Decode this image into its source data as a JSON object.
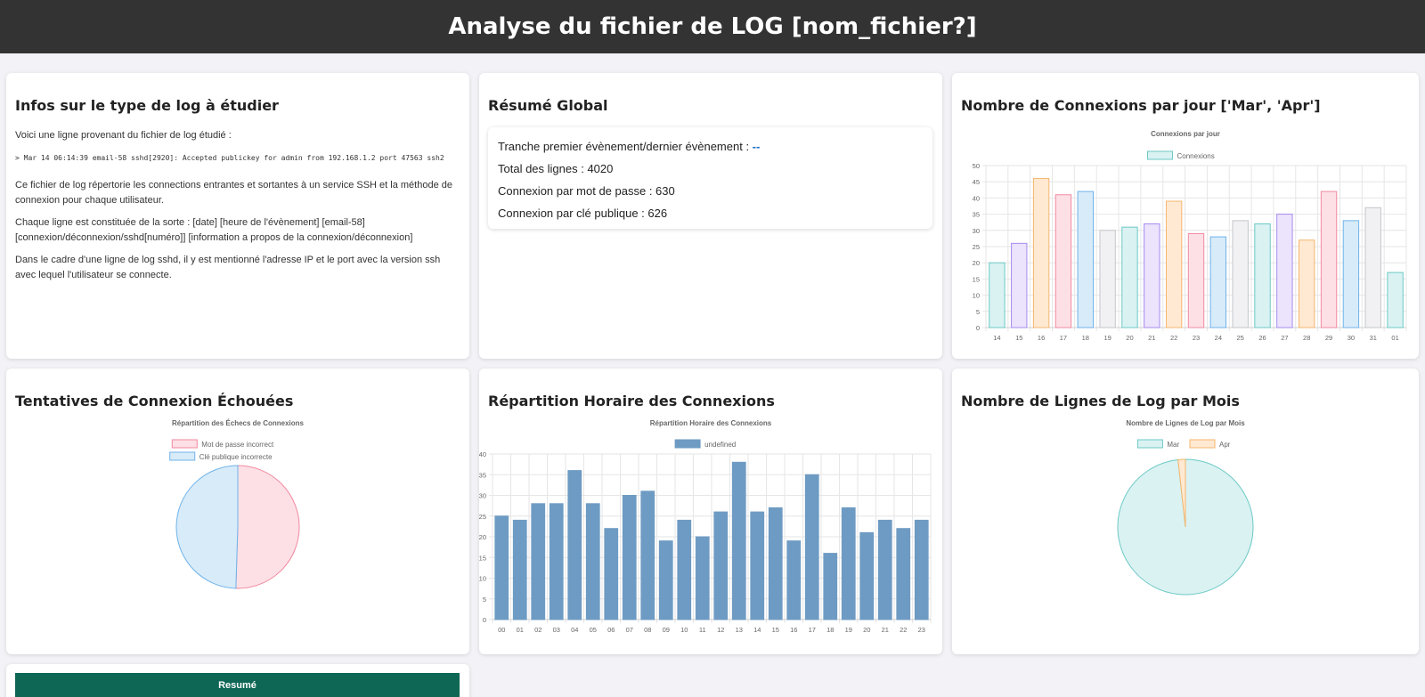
{
  "header": {
    "title": "Analyse du fichier de LOG [nom_fichier?]"
  },
  "infos": {
    "title": "Infos sur le type de log à étudier",
    "intro": "Voici une ligne provenant du fichier de log étudié :",
    "sample_line": "> Mar 14 06:14:39 email-58 sshd[2920]: Accepted publickey for admin from 192.168.1.2 port 47563 ssh2",
    "paragraph1": "Ce fichier de log répertorie les connections entrantes et sortantes à un service SSH et la méthode de connexion pour chaque utilisateur.",
    "paragraph2": "Chaque ligne est constituée de la sorte : [date] [heure de l'évènement] [email-58] [connexion/déconnexion/sshd[numéro]] [information a propos de la connexion/déconnexion]",
    "paragraph3": "Dans le cadre d'une ligne de log sshd, il y est mentionné l'adresse IP et le port avec la version ssh avec lequel l'utilisateur se connecte."
  },
  "resume": {
    "title": "Résumé Global",
    "range_label": "Tranche premier évènement/dernier évènement : ",
    "range_value": "--",
    "total_lines": "Total des lignes : 4020",
    "password_conn": "Connexion par mot de passe : 630",
    "pubkey_conn": "Connexion par clé publique : 626"
  },
  "connections_per_day": {
    "title": "Nombre de Connexions par jour ['Mar', 'Apr']"
  },
  "failed": {
    "title": "Tentatives de Connexion Échouées"
  },
  "hourly": {
    "title": "Répartition Horaire des Connexions"
  },
  "monthly": {
    "title": "Nombre de Lignes de Log par Mois"
  },
  "bottom": {
    "button_label": "Resumé"
  },
  "chart_data": [
    {
      "id": "daily",
      "type": "bar",
      "title": "Connexions par jour",
      "categories": [
        "14",
        "15",
        "16",
        "17",
        "18",
        "19",
        "20",
        "21",
        "22",
        "23",
        "24",
        "25",
        "26",
        "27",
        "28",
        "29",
        "30",
        "31",
        "01"
      ],
      "series": [
        {
          "name": "Connexions",
          "values": [
            20,
            26,
            46,
            41,
            42,
            30,
            31,
            32,
            39,
            29,
            28,
            33,
            32,
            35,
            27,
            42,
            33,
            37,
            17
          ]
        }
      ],
      "ylim": [
        0,
        50
      ],
      "yticks": [
        0,
        5,
        10,
        15,
        20,
        25,
        30,
        35,
        40,
        45,
        50
      ],
      "grid": true,
      "legend": "top",
      "colors": [
        {
          "fill": "#daf2f2",
          "stroke": "#6cc9c5"
        },
        {
          "fill": "#ece3fc",
          "stroke": "#a78bf0"
        },
        {
          "fill": "#ffe9d2",
          "stroke": "#f5b66e"
        },
        {
          "fill": "#fde0e6",
          "stroke": "#f2899f"
        },
        {
          "fill": "#d8ebf9",
          "stroke": "#6fb3ea"
        },
        {
          "fill": "#f1f1f3",
          "stroke": "#c4c6cb"
        }
      ]
    },
    {
      "id": "failed",
      "type": "pie",
      "title": "Répartition des Échecs de Connexions",
      "labels": [
        "Mot de passe incorrect",
        "Clé publique incorrecte"
      ],
      "values": [
        50.5,
        49.5
      ],
      "colors": [
        {
          "fill": "#fde0e6",
          "stroke": "#f2899f"
        },
        {
          "fill": "#d8ebf9",
          "stroke": "#6fb3ea"
        }
      ],
      "legend": "top"
    },
    {
      "id": "hourly",
      "type": "bar",
      "title": "Répartition Horaire des Connexions",
      "categories": [
        "00",
        "01",
        "02",
        "03",
        "04",
        "05",
        "06",
        "07",
        "08",
        "09",
        "10",
        "11",
        "12",
        "13",
        "14",
        "15",
        "16",
        "17",
        "18",
        "19",
        "20",
        "21",
        "22",
        "23"
      ],
      "series": [
        {
          "name": "undefined",
          "values": [
            25,
            24,
            28,
            28,
            36,
            28,
            22,
            30,
            31,
            19,
            24,
            20,
            26,
            38,
            26,
            27,
            19,
            35,
            16,
            27,
            21,
            24,
            22,
            24
          ]
        }
      ],
      "ylim": [
        0,
        40
      ],
      "yticks": [
        0,
        5,
        10,
        15,
        20,
        25,
        30,
        35,
        40
      ],
      "grid": true,
      "legend": "top",
      "color": "#6e9bc3"
    },
    {
      "id": "monthly",
      "type": "pie",
      "title": "Nombre de Lignes de Log par Mois",
      "labels": [
        "Mar",
        "Apr"
      ],
      "values": [
        3950,
        70
      ],
      "colors": [
        {
          "fill": "#daf2f2",
          "stroke": "#6cc9c5"
        },
        {
          "fill": "#ffe9d2",
          "stroke": "#f5b66e"
        }
      ],
      "legend": "top"
    }
  ]
}
